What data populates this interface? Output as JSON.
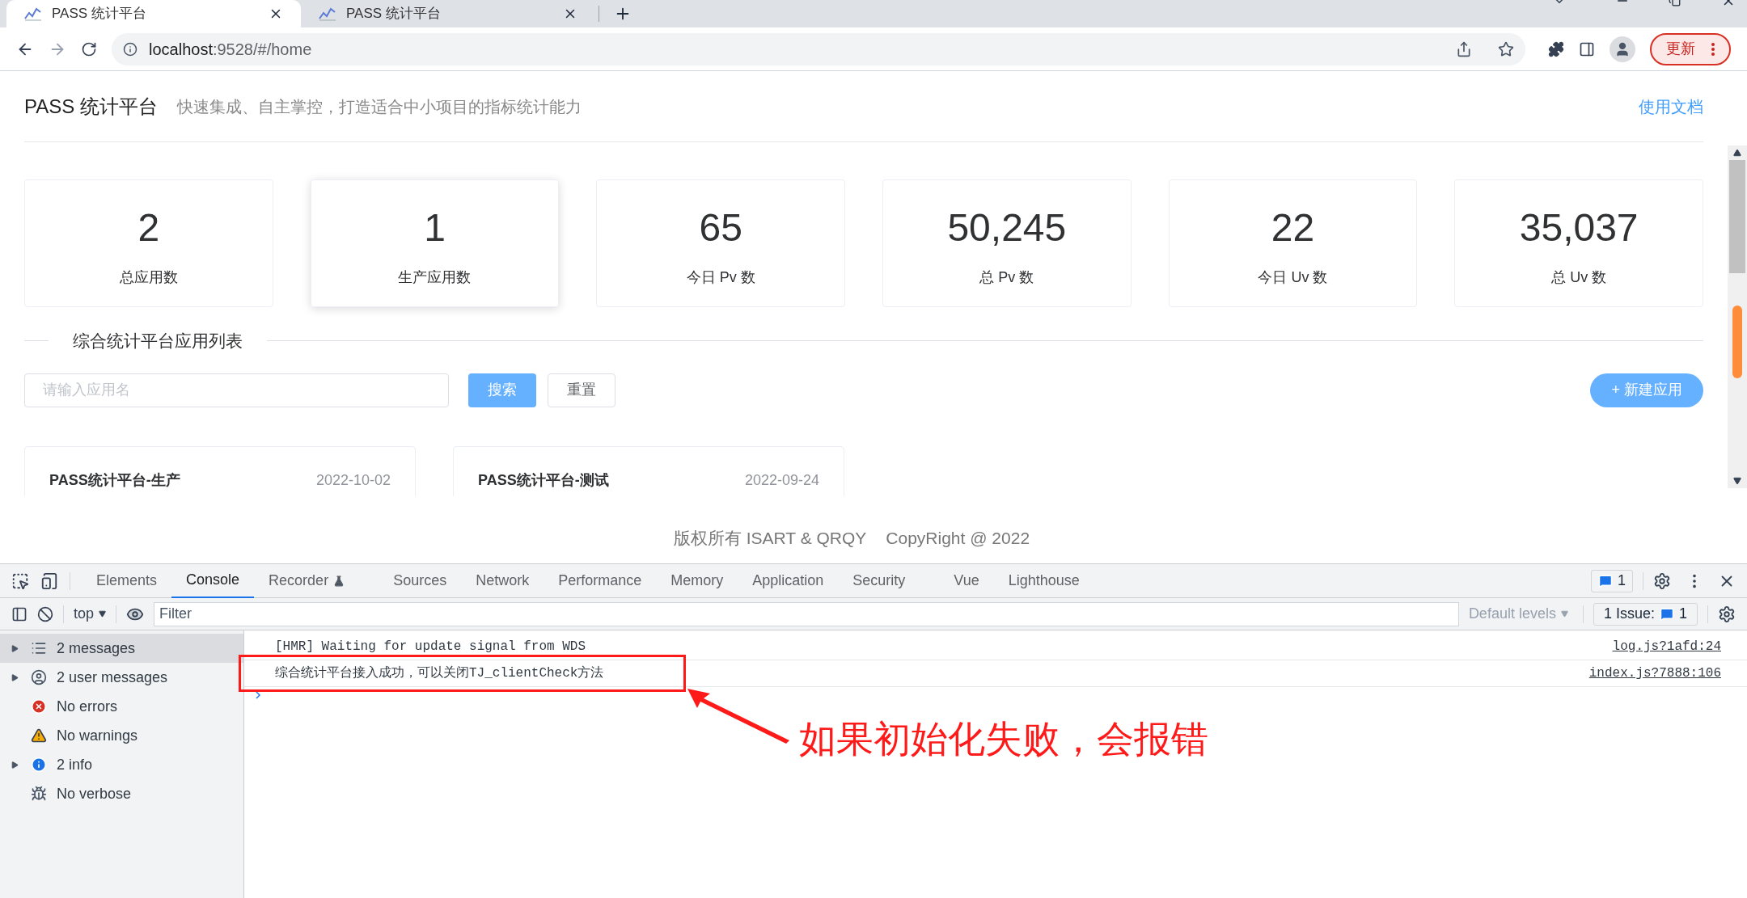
{
  "browser": {
    "tabs": [
      {
        "title": "PASS 统计平台",
        "selected": true
      },
      {
        "title": "PASS 统计平台",
        "selected": false
      }
    ],
    "address": {
      "host": "localhost",
      "rest": ":9528/#/home"
    },
    "update_button": "更新"
  },
  "page": {
    "header": {
      "title": "PASS 统计平台",
      "subtitle": "快速集成、自主掌控，打造适合中小项目的指标统计能力",
      "docs_link": "使用文档"
    },
    "stats": [
      {
        "value": "2",
        "label": "总应用数",
        "hovered": false
      },
      {
        "value": "1",
        "label": "生产应用数",
        "hovered": true
      },
      {
        "value": "65",
        "label": "今日 Pv 数",
        "hovered": false
      },
      {
        "value": "50,245",
        "label": "总 Pv 数",
        "hovered": false
      },
      {
        "value": "22",
        "label": "今日 Uv 数",
        "hovered": false
      },
      {
        "value": "35,037",
        "label": "总 Uv 数",
        "hovered": false
      }
    ],
    "section_title": "综合统计平台应用列表",
    "search": {
      "placeholder": "请输入应用名",
      "search_button": "搜索",
      "reset_button": "重置"
    },
    "new_button": "+ 新建应用",
    "apps": [
      {
        "name": "PASS统计平台-生产",
        "date": "2022-10-02"
      },
      {
        "name": "PASS统计平台-测试",
        "date": "2022-09-24"
      }
    ],
    "footer": [
      "版权所有 ISART & QRQY",
      "CopyRight @ 2022"
    ]
  },
  "devtools": {
    "tabs": [
      {
        "label": "Elements",
        "selected": false
      },
      {
        "label": "Console",
        "selected": true
      },
      {
        "label": "Recorder",
        "selected": false
      },
      {
        "label": "Sources",
        "selected": false
      },
      {
        "label": "Network",
        "selected": false
      },
      {
        "label": "Performance",
        "selected": false
      },
      {
        "label": "Memory",
        "selected": false
      },
      {
        "label": "Application",
        "selected": false
      },
      {
        "label": "Security",
        "selected": false
      },
      {
        "label": "Vue",
        "selected": false
      },
      {
        "label": "Lighthouse",
        "selected": false
      }
    ],
    "message_badge": "1",
    "context": "top",
    "filter_placeholder": "Filter",
    "levels": "Default levels",
    "issues_label": "1 Issue:",
    "issues_count": "1",
    "sidebar": [
      {
        "kind": "list",
        "label": "2 messages",
        "expandable": true,
        "selected": true
      },
      {
        "kind": "user",
        "label": "2 user messages",
        "expandable": true,
        "selected": false
      },
      {
        "kind": "error",
        "label": "No errors",
        "expandable": false,
        "selected": false
      },
      {
        "kind": "warning",
        "label": "No warnings",
        "expandable": false,
        "selected": false
      },
      {
        "kind": "info",
        "label": "2 info",
        "expandable": true,
        "selected": false
      },
      {
        "kind": "verbose",
        "label": "No verbose",
        "expandable": false,
        "selected": false
      }
    ],
    "messages": [
      {
        "text": "[HMR] Waiting for update signal from WDS",
        "source": "log.js?1afd:24"
      },
      {
        "text": "综合统计平台接入成功，可以关闭TJ_clientCheck方法",
        "source": "index.js?7888:106"
      }
    ],
    "annotation": "如果初始化失败，会报错"
  }
}
